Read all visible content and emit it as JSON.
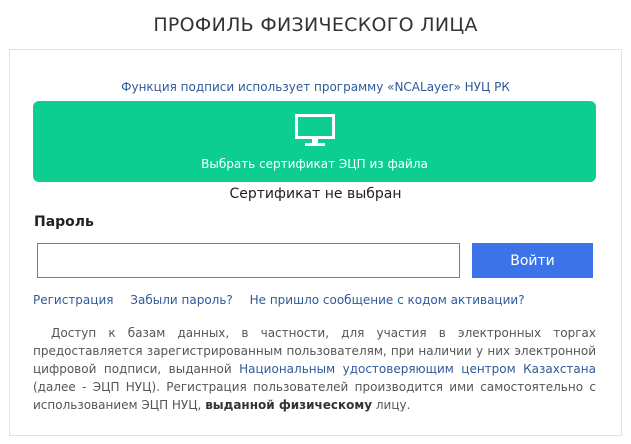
{
  "page": {
    "title": "ПРОФИЛЬ ФИЗИЧЕСКОГО ЛИЦА"
  },
  "signature": {
    "note": "Функция подписи использует программу «NCALayer» НУЦ РК",
    "select_button_label": "Выбрать сертификат ЭЦП из файла",
    "select_button_icon": "monitor-icon",
    "status": "Сертификат не выбран"
  },
  "login": {
    "password_label": "Пароль",
    "password_value": "",
    "submit_label": "Войти"
  },
  "links": {
    "register": "Регистрация",
    "forgot_password": "Забыли пароль?",
    "no_activation": "Не пришло сообщение с кодом активации?"
  },
  "info": {
    "part1": "Доступ к базам данных, в частности, для участия в электронных торгах предоставляется зарегистрированным пользователям, при наличии у них электронной цифровой подписи, выданной ",
    "nuc_link": "Национальным удостоверяющим центром Казахстана",
    "part2": " (далее - ЭЦП НУЦ). Регистрация пользователей производится ими самостоятельно с использованием ЭЦП НУЦ, ",
    "bold": "выданной физическому",
    "part3": " лицу."
  },
  "colors": {
    "accent_green": "#0cce91",
    "button_blue": "#3d73e8",
    "link_blue": "#2f5a99"
  }
}
